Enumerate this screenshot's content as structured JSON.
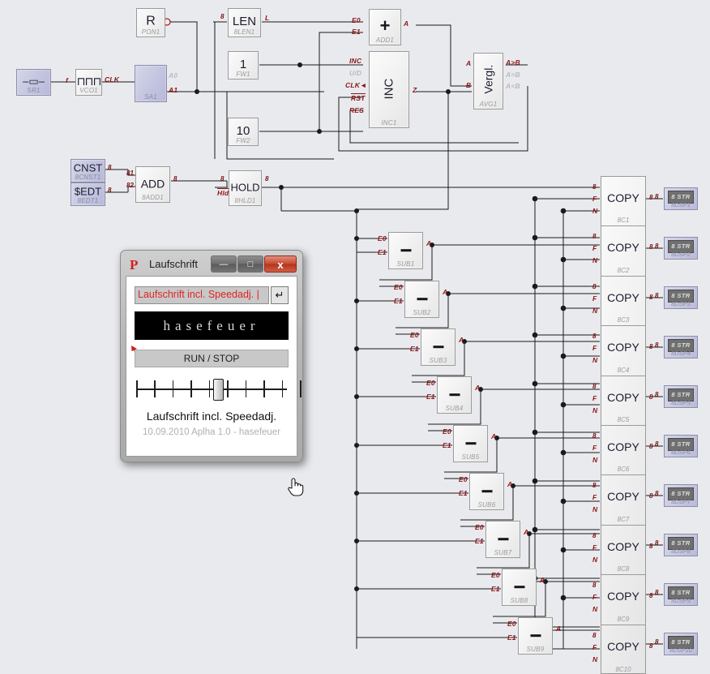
{
  "canvas": {
    "background": "#e9eaee",
    "wire_color": "#1a1a1a",
    "pin_label_color": "#8c1616",
    "block_label_color": "#9b9b9b"
  },
  "blocks": {
    "source": {
      "big": "–▭–",
      "name": "SR1",
      "type": "violet"
    },
    "vco": {
      "big": "⊓⊓⊓",
      "name": "VCO1",
      "out_pin": "CLK",
      "in_pin": "f"
    },
    "switch": {
      "name": "SA1",
      "out_a0": "A0",
      "out_a1": "A1",
      "type": "violet"
    },
    "pon": {
      "big": "R",
      "name": "PON1"
    },
    "len": {
      "big": "LEN",
      "name": "8LEN1",
      "in_bus": "8",
      "out_pin": "L"
    },
    "fw1": {
      "big": "1",
      "name": "FW1"
    },
    "fw2": {
      "big": "10",
      "name": "FW2"
    },
    "add1": {
      "big": "+",
      "name": "ADD1",
      "in0": "E0",
      "in1": "E1",
      "out": "A"
    },
    "inc1": {
      "big": "INC",
      "name": "INC1",
      "pins_in": [
        "INC",
        "U/D",
        "CLK",
        "RST",
        "RES"
      ],
      "pin_out": "Z"
    },
    "vergl": {
      "big": "Vergl.",
      "name": "AVG1",
      "in_a": "A",
      "in_b": "B",
      "out_gt": "A>B",
      "out_eq": "A=B",
      "out_lt": "A<B"
    },
    "cnst": {
      "big": "CNST",
      "name": "8CNST1",
      "bus": "8",
      "type": "violet"
    },
    "sedt": {
      "big": "$EDT",
      "name": "8EDT1",
      "bus": "8",
      "type": "violet"
    },
    "add8": {
      "big": "ADD",
      "name": "8ADD1",
      "in0": "81",
      "in1": "82",
      "out_bus": "8"
    },
    "hold": {
      "big": "HOLD",
      "name": "8HLD1",
      "in_bus": "8",
      "hld_pin": "Hld",
      "out_bus": "8"
    }
  },
  "sub_blocks": [
    {
      "big": "−",
      "name": "SUB1",
      "in0": "E0",
      "in1": "E1",
      "out": "A"
    },
    {
      "big": "−",
      "name": "SUB2",
      "in0": "E0",
      "in1": "E1",
      "out": "A"
    },
    {
      "big": "−",
      "name": "SUB3",
      "in0": "E0",
      "in1": "E1",
      "out": "A"
    },
    {
      "big": "−",
      "name": "SUB4",
      "in0": "E0",
      "in1": "E1",
      "out": "A"
    },
    {
      "big": "−",
      "name": "SUB5",
      "in0": "E0",
      "in1": "E1",
      "out": "A"
    },
    {
      "big": "−",
      "name": "SUB6",
      "in0": "E0",
      "in1": "E1",
      "out": "A"
    },
    {
      "big": "−",
      "name": "SUB7",
      "in0": "E0",
      "in1": "E1",
      "out": "A"
    },
    {
      "big": "−",
      "name": "SUB8",
      "in0": "E0",
      "in1": "E1",
      "out": "A"
    },
    {
      "big": "−",
      "name": "SUB9",
      "in0": "E0",
      "in1": "E1",
      "out": "A"
    }
  ],
  "copy_blocks": [
    {
      "label": "COPY",
      "name": "8C1",
      "in_bus": "8",
      "in_f": "F",
      "in_n": "N",
      "out_bus": "8"
    },
    {
      "label": "COPY",
      "name": "8C2",
      "in_bus": "8",
      "in_f": "F",
      "in_n": "N",
      "out_bus": "8"
    },
    {
      "label": "COPY",
      "name": "8C3",
      "in_bus": "8",
      "in_f": "F",
      "in_n": "N",
      "out_bus": "8"
    },
    {
      "label": "COPY",
      "name": "8C4",
      "in_bus": "8",
      "in_f": "F",
      "in_n": "N",
      "out_bus": "8"
    },
    {
      "label": "COPY",
      "name": "8C5",
      "in_bus": "8",
      "in_f": "F",
      "in_n": "N",
      "out_bus": "8"
    },
    {
      "label": "COPY",
      "name": "8C6",
      "in_bus": "8",
      "in_f": "F",
      "in_n": "N",
      "out_bus": "8"
    },
    {
      "label": "COPY",
      "name": "8C7",
      "in_bus": "8",
      "in_f": "F",
      "in_n": "N",
      "out_bus": "8"
    },
    {
      "label": "COPY",
      "name": "8C8",
      "in_bus": "8",
      "in_f": "F",
      "in_n": "N",
      "out_bus": "8"
    },
    {
      "label": "COPY",
      "name": "8C9",
      "in_bus": "8",
      "in_f": "F",
      "in_n": "N",
      "out_bus": "8"
    },
    {
      "label": "COPY",
      "name": "8C10",
      "in_bus": "8",
      "in_f": "F",
      "in_n": "N",
      "out_bus": "8"
    }
  ],
  "displays": [
    {
      "screen": "8 STR",
      "name": "8DSP1",
      "in_bus": "8"
    },
    {
      "screen": "8 STR",
      "name": "8DSP2",
      "in_bus": "8"
    },
    {
      "screen": "8 STR",
      "name": "8DSP3",
      "in_bus": "8"
    },
    {
      "screen": "8 STR",
      "name": "8DSP4",
      "in_bus": "8"
    },
    {
      "screen": "8 STR",
      "name": "8DSP5",
      "in_bus": "8"
    },
    {
      "screen": "8 STR",
      "name": "8DSP6",
      "in_bus": "8"
    },
    {
      "screen": "8 STR",
      "name": "8DSP7",
      "in_bus": "8"
    },
    {
      "screen": "8 STR",
      "name": "8DSP8",
      "in_bus": "8"
    },
    {
      "screen": "8 STR",
      "name": "8DSP9",
      "in_bus": "8"
    },
    {
      "screen": "8 STR",
      "name": "8DSP10",
      "in_bus": "8"
    }
  ],
  "dialog": {
    "title": "Laufschrift",
    "app_logo": "P",
    "minimize_label": "—",
    "maximize_label": "□",
    "close_label": "x",
    "text_input_value": "Laufschrift incl. Speedadj. | ",
    "enter_button_label": "↵",
    "marquee_text": "hasefeuer",
    "run_stop_label": "RUN / STOP",
    "slider_value_percent": 50,
    "caption": "Laufschrift incl. Speedadj.",
    "subcaption": "10.09.2010 Aplha 1.0 - hasefeuer"
  },
  "cursor": {
    "type": "pointing-hand"
  }
}
